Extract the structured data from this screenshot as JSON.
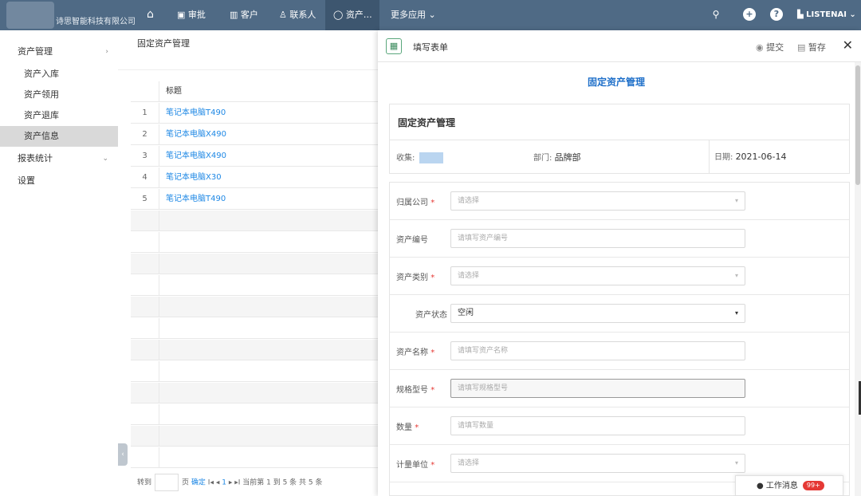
{
  "topbar": {
    "company": "诗思智能科技有限公司",
    "nav": [
      {
        "label": "审批",
        "icon": "approval-icon"
      },
      {
        "label": "客户",
        "icon": "customer-icon"
      },
      {
        "label": "联系人",
        "icon": "contacts-icon"
      },
      {
        "label": "资产…",
        "icon": "shield-icon"
      }
    ],
    "more_apps": "更多应用 ⌄",
    "user": "LISTENAI ⌄"
  },
  "sidebar": {
    "items": [
      {
        "label": "资产管理",
        "kind": "parent",
        "expanded": true
      },
      {
        "label": "资产入库",
        "kind": "child"
      },
      {
        "label": "资产领用",
        "kind": "child"
      },
      {
        "label": "资产退库",
        "kind": "child"
      },
      {
        "label": "资产信息",
        "kind": "child",
        "active": true
      },
      {
        "label": "报表统计",
        "kind": "parent"
      },
      {
        "label": "设置",
        "kind": "parent"
      }
    ]
  },
  "list": {
    "page_title": "固定资产管理",
    "column_title": "标题",
    "rows": [
      {
        "num": "1",
        "title": "笔记本电脑T490"
      },
      {
        "num": "2",
        "title": "笔记本电脑X490"
      },
      {
        "num": "3",
        "title": "笔记本电脑X490"
      },
      {
        "num": "4",
        "title": "笔记本电脑X30"
      },
      {
        "num": "5",
        "title": "笔记本电脑T490"
      }
    ],
    "pager": {
      "goto": "转到",
      "page_unit": "页",
      "confirm": "确定",
      "nav": "I◂ ◂",
      "current": "1",
      "nav_next": "▸ ▸I",
      "summary": "当前第 1 到 5 条 共 5 条"
    }
  },
  "panel": {
    "header_title": "填写表单",
    "submit": "提交",
    "save_draft": "暂存",
    "form_title": "固定资产管理",
    "card_title": "固定资产管理",
    "collector_label": "收集:",
    "dept_label": "部门:",
    "dept_value": "品牌部",
    "date_label": "日期:",
    "date_value": "2021-06-14",
    "fields": [
      {
        "label": "归属公司",
        "required": true,
        "placeholder": "请选择",
        "type": "select"
      },
      {
        "label": "资产编号",
        "required": false,
        "placeholder": "请填写资产编号",
        "type": "text"
      },
      {
        "label": "资产类别",
        "required": true,
        "placeholder": "请选择",
        "type": "select"
      },
      {
        "label": "资产状态",
        "required": false,
        "value": "空闲",
        "type": "select-filled"
      },
      {
        "label": "资产名称",
        "required": true,
        "placeholder": "请填写资产名称",
        "type": "text"
      },
      {
        "label": "规格型号",
        "required": true,
        "placeholder": "请填写规格型号",
        "type": "text-focus"
      },
      {
        "label": "数量",
        "required": true,
        "placeholder": "请填写数量",
        "type": "text"
      },
      {
        "label": "计量单位",
        "required": true,
        "placeholder": "请选择",
        "type": "select"
      }
    ]
  },
  "messages": {
    "label": "工作消息",
    "badge": "99+"
  }
}
